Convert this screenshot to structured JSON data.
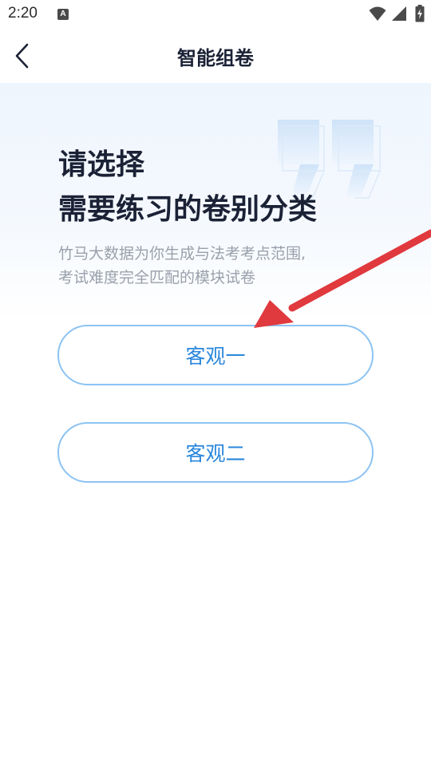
{
  "status_bar": {
    "time": "2:20",
    "notification_icon": "a-icon",
    "icons": [
      "wifi-icon",
      "signal-icon",
      "battery-charging-icon"
    ]
  },
  "nav": {
    "title": "智能组卷",
    "back_icon": "chevron-left-icon"
  },
  "main": {
    "heading_line1": "请选择",
    "heading_line2": "需要练习的卷别分类",
    "subtitle_line1": "竹马大数据为你生成与法考考点范围,",
    "subtitle_line2": "考试难度完全匹配的模块试卷",
    "options": [
      {
        "label": "客观一"
      },
      {
        "label": "客观二"
      }
    ]
  },
  "annotation": {
    "type": "red-arrow",
    "color": "#e0393e",
    "points_to": "客观一"
  },
  "colors": {
    "accent": "#2a87dc",
    "button_border": "#8cc3f3",
    "heading": "#1b2236",
    "subtitle": "#9aa0ab"
  }
}
